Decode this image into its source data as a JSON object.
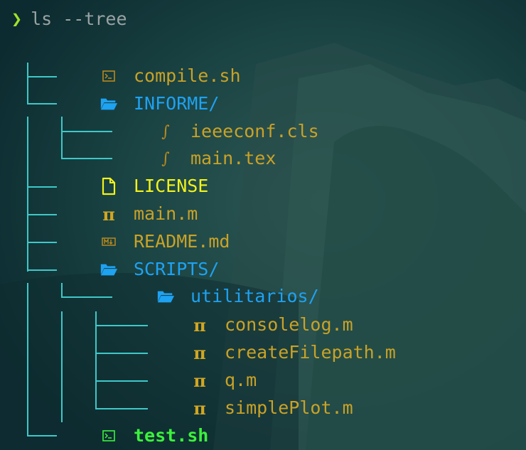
{
  "colors": {
    "background": "#0f3238",
    "tree_lines": "#3ec8c8",
    "file_name": "#c9a227",
    "directory": "#1ea2f2",
    "license": "#f2f21a",
    "executable_selected": "#3cf23c",
    "prompt_caret": "#9fe22a"
  },
  "prompt": {
    "caret": "❯",
    "command": "ls --tree"
  },
  "tree": {
    "compile_sh": {
      "name": "compile.sh",
      "icon": "terminal-icon"
    },
    "informe": {
      "name": "INFORME/",
      "icon": "folder-open-icon"
    },
    "ieeeconf": {
      "name": "ieeeconf.cls",
      "icon": "tex-icon"
    },
    "main_tex": {
      "name": "main.tex",
      "icon": "tex-icon"
    },
    "license": {
      "name": "LICENSE",
      "icon": "file-icon"
    },
    "main_m": {
      "name": "main.m",
      "icon": "pi-icon",
      "glyph": "π"
    },
    "readme": {
      "name": "README.md",
      "icon": "markdown-icon"
    },
    "scripts": {
      "name": "SCRIPTS/",
      "icon": "folder-open-icon"
    },
    "utilitarios": {
      "name": "utilitarios/",
      "icon": "folder-open-icon"
    },
    "consolelog": {
      "name": "consolelog.m",
      "icon": "pi-icon",
      "glyph": "π"
    },
    "createfilepath": {
      "name": "createFilepath.m",
      "icon": "pi-icon",
      "glyph": "π"
    },
    "q_m": {
      "name": "q.m",
      "icon": "pi-icon",
      "glyph": "π"
    },
    "simpleplot": {
      "name": "simplePlot.m",
      "icon": "pi-icon",
      "glyph": "π"
    },
    "test_sh": {
      "name": "test.sh",
      "icon": "terminal-icon"
    }
  }
}
